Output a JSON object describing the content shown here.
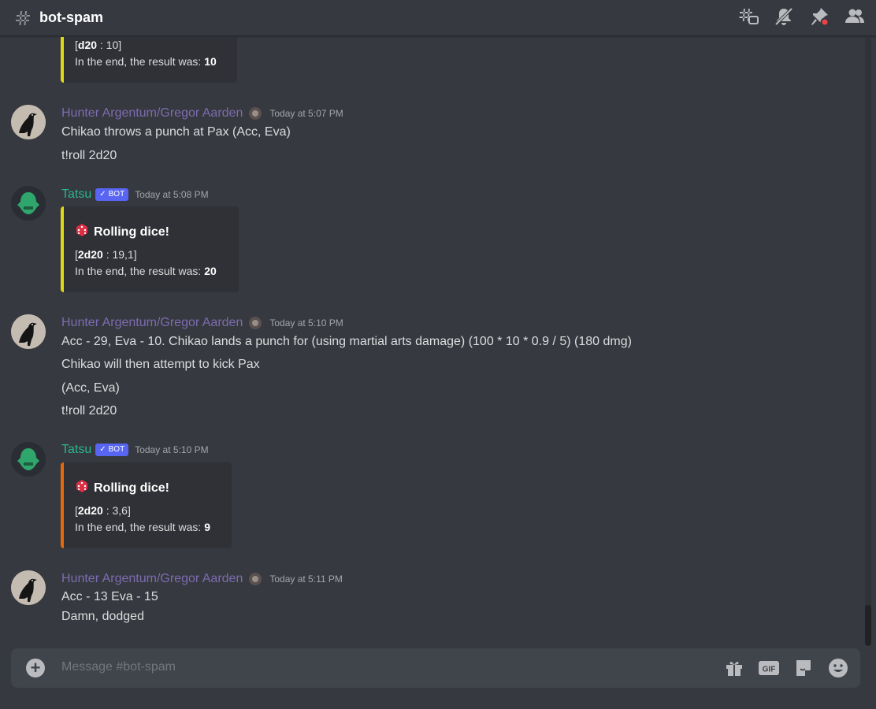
{
  "header": {
    "channel": "bot-spam",
    "icons": [
      "threads-icon",
      "notification-muted-icon",
      "pin-icon",
      "member-list-icon"
    ]
  },
  "colors": {
    "background": "#36393f",
    "embed_yellow": "#e1d815",
    "embed_orange": "#e8690b",
    "hunter_name": "#7e6bb0",
    "tatsu_name": "#26b88a",
    "bot_tag": "#5865f2"
  },
  "messages": {
    "m0": {
      "desc1_pre": "[",
      "desc1_bold": "d20",
      "desc1_post": " : 10]",
      "desc2_pre": "In the end, the result was: ",
      "desc2_bold": "10"
    },
    "m1": {
      "author": "Hunter Argentum/Gregor Aarden",
      "time": "Today at 5:07 PM",
      "lines": [
        "Chikao throws a punch at Pax (Acc, Eva)",
        "t!roll 2d20"
      ]
    },
    "m2": {
      "author": "Tatsu",
      "bot": "BOT",
      "time": "Today at 5:08 PM",
      "title": "Rolling dice!",
      "desc1_pre": "[",
      "desc1_bold": "2d20",
      "desc1_post": " : 19,1]",
      "desc2_pre": "In the end, the result was: ",
      "desc2_bold": "20"
    },
    "m3": {
      "author": "Hunter Argentum/Gregor Aarden",
      "time": "Today at 5:10 PM",
      "lines": [
        "Acc - 29, Eva - 10. Chikao lands a punch for (using martial arts damage) (100 * 10 * 0.9 / 5) (180 dmg)",
        "Chikao will then attempt to kick Pax",
        "(Acc, Eva)",
        "t!roll 2d20"
      ]
    },
    "m4": {
      "author": "Tatsu",
      "bot": "BOT",
      "time": "Today at 5:10 PM",
      "title": "Rolling dice!",
      "desc1_pre": "[",
      "desc1_bold": "2d20",
      "desc1_post": " : 3,6]",
      "desc2_pre": "In the end, the result was: ",
      "desc2_bold": "9"
    },
    "m5": {
      "author": "Hunter Argentum/Gregor Aarden",
      "time": "Today at 5:11 PM",
      "lines": [
        "Acc - 13 Eva - 15",
        "Damn, dodged"
      ]
    }
  },
  "composer": {
    "placeholder": "Message #bot-spam",
    "gif_label": "GIF",
    "icons": [
      "add-attachment-icon",
      "gift-icon",
      "gif-icon",
      "sticker-icon",
      "emoji-icon"
    ]
  }
}
